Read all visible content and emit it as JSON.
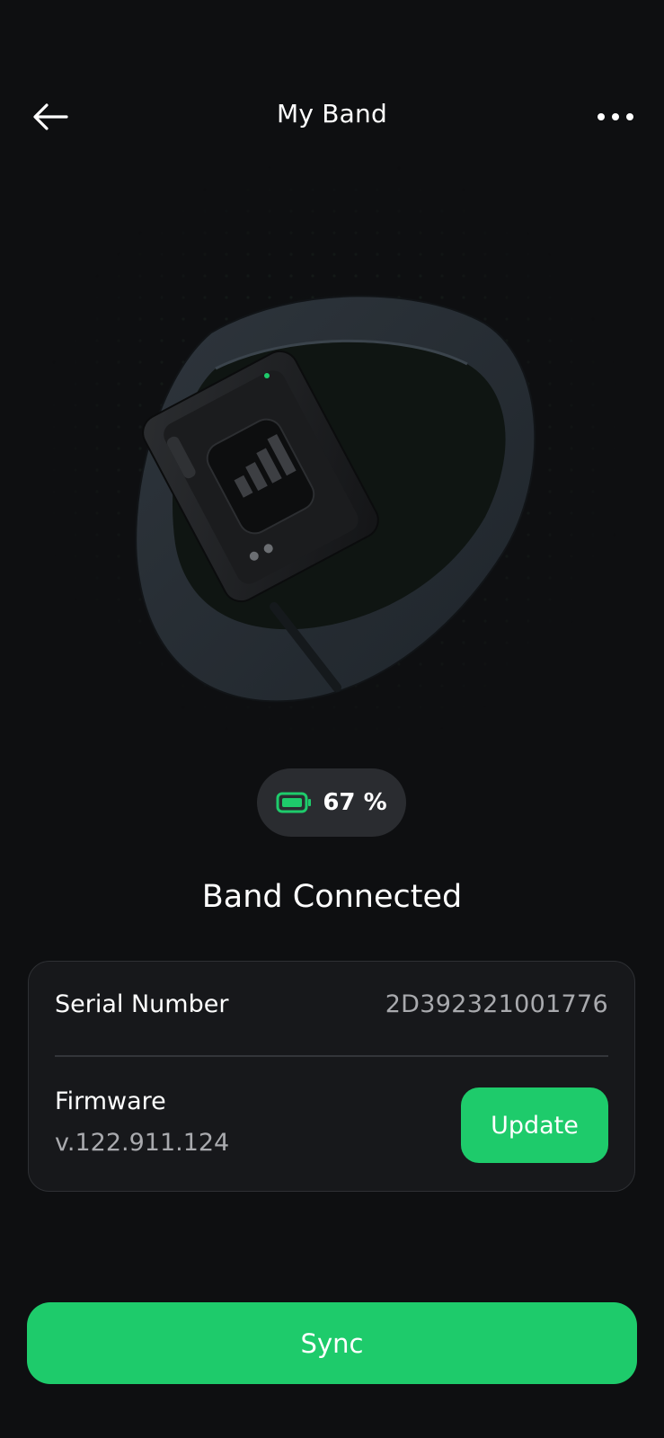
{
  "header": {
    "title": "My Band",
    "back_icon": "arrow-left-icon",
    "more_icon": "more-horizontal-icon"
  },
  "hero": {
    "image": "fitness-band-product-image"
  },
  "battery": {
    "level_text": "67 %",
    "level": 0.67,
    "icon": "battery-icon",
    "color": "#1ecb6b"
  },
  "status": {
    "text": "Band Connected"
  },
  "device_info": {
    "serial_label": "Serial Number",
    "serial_value": "2D392321001776",
    "firmware_label": "Firmware",
    "firmware_version": "v.122.911.124",
    "update_label": "Update"
  },
  "actions": {
    "sync_label": "Sync"
  },
  "colors": {
    "background": "#0e0f11",
    "accent": "#1ecb6b",
    "card": "#17181b",
    "muted_text": "#a9aaae"
  }
}
